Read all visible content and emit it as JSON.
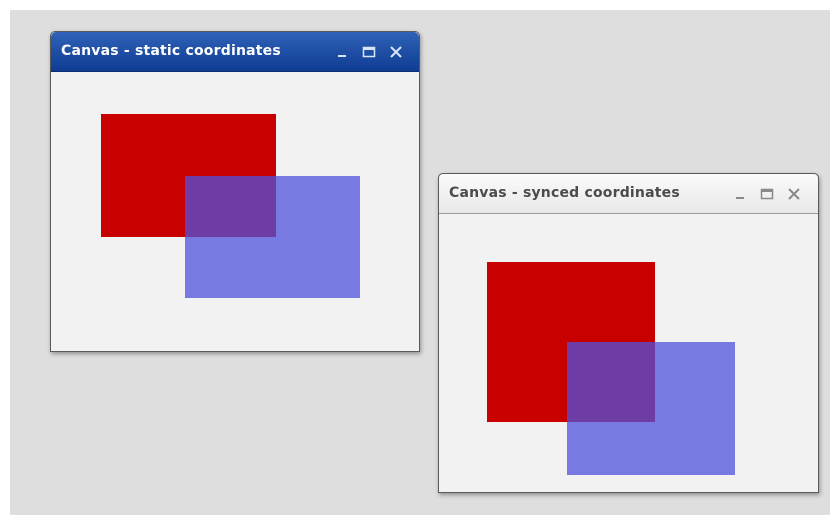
{
  "windows": [
    {
      "title": "Canvas - static coordinates",
      "active": true,
      "controls": [
        "minimize-icon",
        "maximize-icon",
        "close-icon"
      ],
      "colors": {
        "titlebar": "#1f4fa8",
        "red_shape": "#c80000",
        "blue_shape": "#5050dc"
      }
    },
    {
      "title": "Canvas - synced coordinates",
      "active": false,
      "controls": [
        "minimize-icon",
        "maximize-icon",
        "close-icon"
      ],
      "colors": {
        "titlebar": "#f0f0f0",
        "red_shape": "#c80000",
        "blue_shape": "#5050dc"
      }
    }
  ]
}
